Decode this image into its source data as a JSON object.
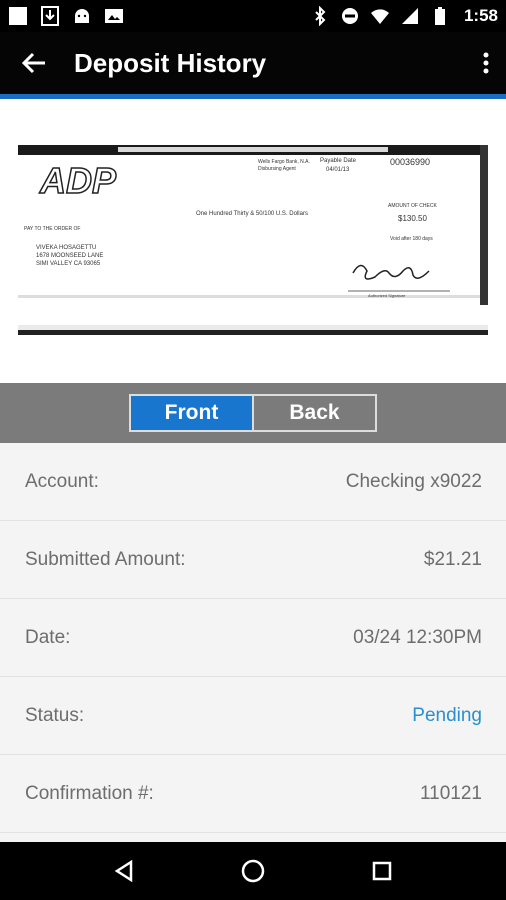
{
  "status_bar": {
    "time": "1:58",
    "icons": [
      "notification-square-icon",
      "download-icon",
      "android-icon",
      "photo-icon",
      "bluetooth-icon",
      "do-not-disturb-icon",
      "wifi-icon",
      "signal-icon",
      "battery-icon"
    ]
  },
  "app_bar": {
    "title": "Deposit History"
  },
  "check": {
    "payer_line1": "Wells Fargo Bank, N.A.",
    "payer_line2": "Disbursing Agent",
    "payable_date_label": "Payable Date",
    "payable_date": "04/01/13",
    "check_number": "00036990",
    "logo": "ADP",
    "amount_words": "One Hundred Thirty & 50/100 U.S. Dollars",
    "amount_label": "AMOUNT OF CHECK",
    "amount": "$130.50",
    "pay_to_label": "PAY TO THE ORDER OF",
    "payee_name": "VIVEKA HOSAGETTU",
    "payee_address1": "1678 MOONSEED LANE",
    "payee_address2": "SIMI VALLEY CA 93065",
    "void_note": "Void after 180 days",
    "signature_caption": "Authorized Signature"
  },
  "toggle": {
    "front_label": "Front",
    "back_label": "Back"
  },
  "details": [
    {
      "label": "Account:",
      "value": "Checking x9022"
    },
    {
      "label": "Submitted Amount:",
      "value": "$21.21"
    },
    {
      "label": "Date:",
      "value": "03/24 12:30PM"
    },
    {
      "label": "Status:",
      "value": "Pending",
      "value_color": "#2a8fd0"
    },
    {
      "label": "Confirmation #:",
      "value": "110121"
    }
  ],
  "colors": {
    "accent": "#1a6cc4",
    "active_tab": "#1976cf",
    "pending": "#2a8fd0"
  }
}
